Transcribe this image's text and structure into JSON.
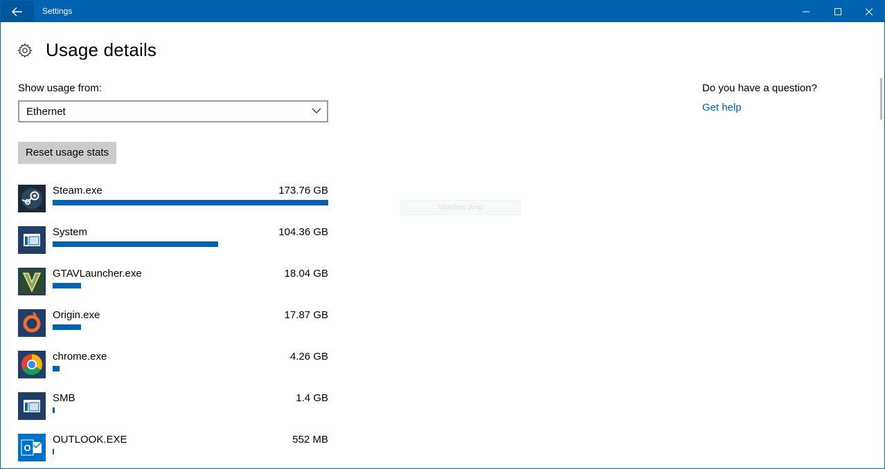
{
  "window": {
    "title": "Settings"
  },
  "header": {
    "title": "Usage details",
    "icon": "gear-icon"
  },
  "usage_source": {
    "label": "Show usage from:",
    "selected": "Ethernet"
  },
  "reset_button": {
    "label": "Reset usage stats"
  },
  "apps": [
    {
      "name": "Steam.exe",
      "size": "173.76 GB",
      "usage_fraction": 1.0,
      "icon": "steam-icon"
    },
    {
      "name": "System",
      "size": "104.36 GB",
      "usage_fraction": 0.6,
      "icon": "system-window-icon"
    },
    {
      "name": "GTAVLauncher.exe",
      "size": "18.04 GB",
      "usage_fraction": 0.104,
      "icon": "gtav-icon"
    },
    {
      "name": "Origin.exe",
      "size": "17.87 GB",
      "usage_fraction": 0.103,
      "icon": "origin-icon"
    },
    {
      "name": "chrome.exe",
      "size": "4.26 GB",
      "usage_fraction": 0.025,
      "icon": "chrome-icon"
    },
    {
      "name": "SMB",
      "size": "1.4 GB",
      "usage_fraction": 0.008,
      "icon": "system-window-icon"
    },
    {
      "name": "OUTLOOK.EXE",
      "size": "552 MB",
      "usage_fraction": 0.003,
      "icon": "outlook-icon"
    }
  ],
  "overlay": {
    "text": "Window Snip"
  },
  "help": {
    "question": "Do you have a question?",
    "link": "Get help"
  },
  "colors": {
    "accent": "#0063b1",
    "titlebar": "#0063b1",
    "back_button": "#00559b",
    "button_gray": "#cccccc"
  }
}
